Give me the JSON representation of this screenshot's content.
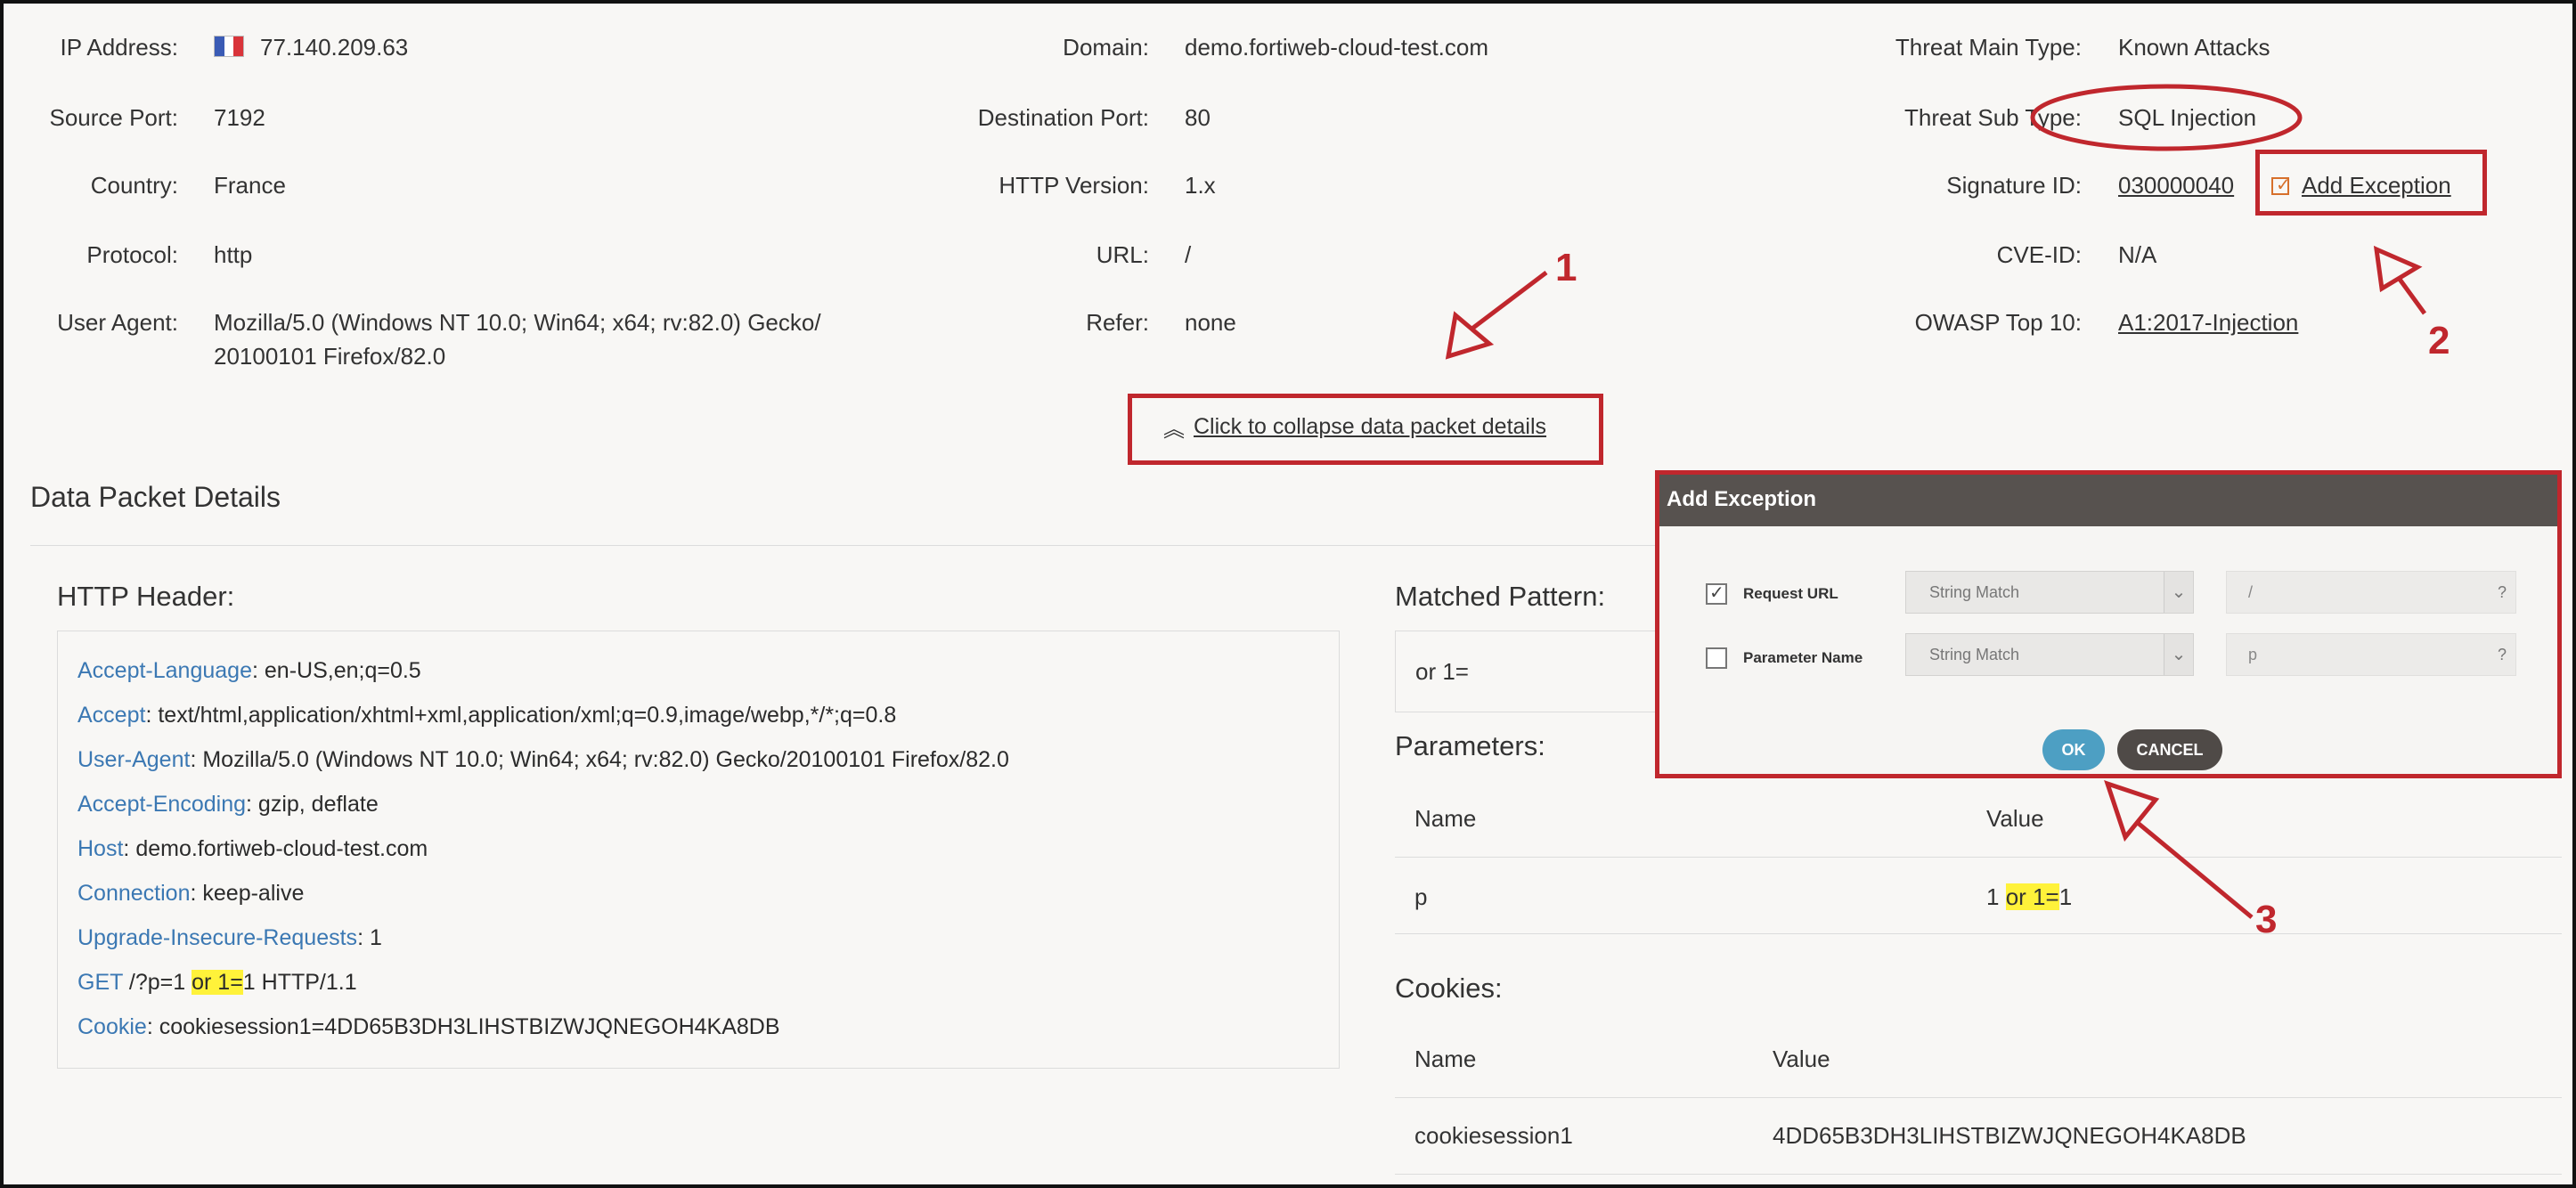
{
  "info": {
    "col1": [
      {
        "label": "IP Address:",
        "value": "77.140.209.63"
      },
      {
        "label": "Source Port:",
        "value": "7192"
      },
      {
        "label": "Country:",
        "value": "France"
      },
      {
        "label": "Protocol:",
        "value": "http"
      },
      {
        "label": "User Agent:",
        "value": "Mozilla/5.0 (Windows NT 10.0; Win64; x64; rv:82.0) Gecko/",
        "value2": "20100101 Firefox/82.0"
      }
    ],
    "col2": [
      {
        "label": "Domain:",
        "value": "demo.fortiweb-cloud-test.com"
      },
      {
        "label": "Destination Port:",
        "value": "80"
      },
      {
        "label": "HTTP Version:",
        "value": "1.x"
      },
      {
        "label": "URL:",
        "value": "/"
      },
      {
        "label": "Refer:",
        "value": "none"
      }
    ],
    "col3": [
      {
        "label": "Threat Main Type:",
        "value": "Known Attacks"
      },
      {
        "label": "Threat Sub Type:",
        "value": "SQL Injection"
      },
      {
        "label": "Signature ID:",
        "value": "030000040"
      },
      {
        "label": "CVE-ID:",
        "value": "N/A"
      },
      {
        "label": "OWASP Top 10:",
        "value": "A1:2017-Injection"
      }
    ],
    "add_exception_label": "Add Exception",
    "collapse_label": "Click to collapse data packet details"
  },
  "packet": {
    "title": "Data Packet Details",
    "http_header_title": "HTTP Header:",
    "headers": [
      {
        "key": "Accept-Language",
        "value": "en-US,en;q=0.5"
      },
      {
        "key": "Accept",
        "value": "text/html,application/xhtml+xml,application/xml;q=0.9,image/webp,*/*;q=0.8"
      },
      {
        "key": "User-Agent",
        "value": "Mozilla/5.0 (Windows NT 10.0; Win64; x64; rv:82.0) Gecko/20100101 Firefox/82.0"
      },
      {
        "key": "Accept-Encoding",
        "value": "gzip, deflate"
      },
      {
        "key": "Host",
        "value": "demo.fortiweb-cloud-test.com"
      },
      {
        "key": "Connection",
        "value": "keep-alive"
      },
      {
        "key": "Upgrade-Insecure-Requests",
        "value": "1"
      },
      {
        "key": "Cookie",
        "value": "cookiesession1=4DD65B3DH3LIHSTBIZWJQNEGOH4KA8DB"
      }
    ],
    "get_line": {
      "method": "GET",
      "pre": "/?p=1 ",
      "match": "or 1=",
      "post": "1 HTTP/1.1"
    },
    "matched_pattern_title": "Matched Pattern:",
    "matched_pattern": "or 1=",
    "parameters_title": "Parameters:",
    "param_cols": [
      "Name",
      "Value"
    ],
    "param_row": {
      "name": "p",
      "pre": "1 ",
      "match": "or 1=",
      "post": "1"
    },
    "cookies_title": "Cookies:",
    "cookie_cols": [
      "Name",
      "Value"
    ],
    "cookie_row": {
      "name": "cookiesession1",
      "value": "4DD65B3DH3LIHSTBIZWJQNEGOH4KA8DB"
    }
  },
  "modal": {
    "title": "Add Exception",
    "rows": [
      {
        "label": "Request URL",
        "checked": true,
        "match": "String Match",
        "value": "/"
      },
      {
        "label": "Parameter Name",
        "checked": false,
        "match": "String Match",
        "value": "p"
      }
    ],
    "ok": "OK",
    "cancel": "CANCEL",
    "help_glyph": "?"
  },
  "annotations": {
    "n1": "1",
    "n2": "2",
    "n3": "3"
  },
  "colors": {
    "annotation_red": "#c0272d",
    "link_blue": "#3b78b3",
    "highlight": "#fff23a",
    "modal_header": "#57524f",
    "ok": "#4d9fc3",
    "cancel": "#4f4a47"
  }
}
